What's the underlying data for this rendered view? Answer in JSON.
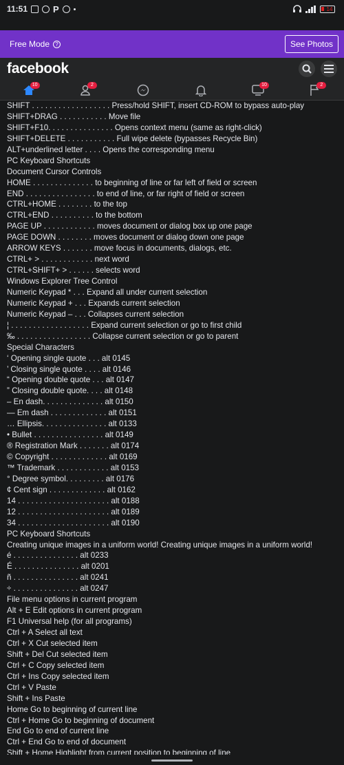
{
  "status_bar": {
    "time": "11:51",
    "icons": [
      "message-icon",
      "facebook-icon",
      "p-icon",
      "shield-icon",
      "dot"
    ],
    "right_icons": [
      "headset-icon",
      "signal-icon",
      "battery-icon"
    ],
    "battery_level": "14"
  },
  "free_mode": {
    "label": "Free Mode",
    "help_glyph": "?",
    "button_label": "See Photos"
  },
  "header": {
    "logo": "facebook"
  },
  "nav": {
    "tabs": [
      {
        "name": "home",
        "badge": "10"
      },
      {
        "name": "friends",
        "badge": "2"
      },
      {
        "name": "messenger",
        "badge": ""
      },
      {
        "name": "notifications",
        "badge": ""
      },
      {
        "name": "watch",
        "badge": "10"
      },
      {
        "name": "pages",
        "badge": "2"
      }
    ]
  },
  "lines": [
    "SHIFT . . . . . . . . . . . . . . . . . . Press/hold SHIFT, insert CD-ROM to bypass auto-play",
    "SHIFT+DRAG . . . . . . . . . . . Move file",
    "SHIFT+F10. . . . . . . . . . . . . . . Opens context menu (same as right-click)",
    "SHIFT+DELETE . . . . . . . . . . . Full wipe delete (bypasses Recycle Bin)",
    "ALT+underlined letter . . . . Opens the corresponding menu",
    "PC Keyboard Shortcuts",
    "Document Cursor Controls",
    "HOME . . . . . . . . . . . . . . to beginning of line or far left of field or screen",
    "END . . . . . . . . . . . . . . . . to end of line, or far right of field or screen",
    "CTRL+HOME . . . . . . . . to the top",
    "CTRL+END . . . . . . . . . . to the bottom",
    "PAGE UP . . . . . . . . . . . . moves document or dialog box up one page",
    "PAGE DOWN . . . . . . . . moves document or dialog down one page",
    "ARROW KEYS . . . . . . . move focus in documents, dialogs, etc.",
    "CTRL+ > . . . . . . . . . . . . next word",
    "CTRL+SHIFT+ > . . . . . . selects word",
    "Windows Explorer Tree Control",
    "Numeric Keypad * . . . Expand all under current selection",
    "Numeric Keypad + . . . Expands current selection",
    "Numeric Keypad – . . . Collapses current selection",
    "¦ . . . . . . . . . . . . . . . . . . Expand current selection or go to first child",
    "‰ . . . . . . . . . . . . . . . . . Collapse current selection or go to parent",
    "Special Characters",
    "‘ Opening single quote . . . alt 0145",
    "’ Closing single quote . . . . alt 0146",
    "“ Opening double quote . . . alt 0147",
    "” Closing double quote. . . . alt 0148",
    "– En dash. . . . . . . . . . . . . . alt 0150",
    "— Em dash . . . . . . . . . . . . . alt 0151",
    "… Ellipsis. . . . . . . . . . . . . . . alt 0133",
    "• Bullet . . . . . . . . . . . . . . . . alt 0149",
    "® Registration Mark . . . . . . . alt 0174",
    "© Copyright . . . . . . . . . . . . . alt 0169",
    "™ Trademark . . . . . . . . . . . . alt 0153",
    "° Degree symbol. . . . . . . . . alt 0176",
    "¢ Cent sign . . . . . . . . . . . . . alt 0162",
    "14 . . . . . . . . . . . . . . . . . . . . . alt 0188",
    "12 . . . . . . . . . . . . . . . . . . . . . alt 0189",
    "34 . . . . . . . . . . . . . . . . . . . . . alt 0190",
    "PC Keyboard Shortcuts",
    "Creating unique images in a uniform world! Creating unique images in a uniform world!",
    "é . . . . . . . . . . . . . . . alt 0233",
    "É . . . . . . . . . . . . . . . alt 0201",
    "ñ . . . . . . . . . . . . . . . alt 0241",
    "÷ . . . . . . . . . . . . . . . alt 0247",
    "File menu options in current program",
    "Alt + E Edit options in current program",
    "F1 Universal help (for all programs)",
    "Ctrl + A Select all text",
    "Ctrl + X Cut selected item",
    "Shift + Del Cut selected item",
    "Ctrl + C Copy selected item",
    "Ctrl + Ins Copy selected item",
    "Ctrl + V Paste",
    "Shift + Ins Paste",
    "Home Go to beginning of current line",
    "Ctrl + Home Go to beginning of document",
    "End Go to end of current line",
    "Ctrl + End Go to end of document",
    "Shift + Home Highlight from current position to beginning of line"
  ]
}
